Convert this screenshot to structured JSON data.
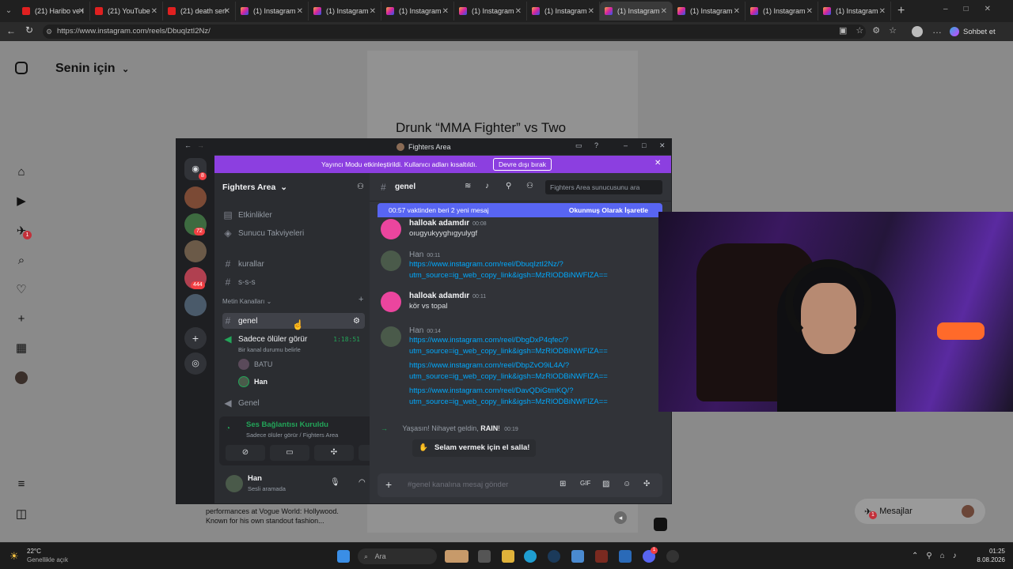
{
  "browser": {
    "tabs": [
      {
        "title": "(21) Haribo ve I",
        "icon": "youtube-icon"
      },
      {
        "title": "(21) YouTube",
        "icon": "youtube-icon"
      },
      {
        "title": "(21) death seri",
        "icon": "youtube-icon"
      },
      {
        "title": "(1) Instagram",
        "icon": "instagram-icon"
      },
      {
        "title": "(1) Instagram",
        "icon": "instagram-icon"
      },
      {
        "title": "(1) Instagram",
        "icon": "instagram-icon"
      },
      {
        "title": "(1) Instagram",
        "icon": "instagram-icon"
      },
      {
        "title": "(1) Instagram",
        "icon": "instagram-icon"
      },
      {
        "title": "(1) Instagram",
        "icon": "instagram-icon"
      },
      {
        "title": "(1) Instagram",
        "icon": "instagram-icon"
      },
      {
        "title": "(1) Instagram",
        "icon": "instagram-icon"
      },
      {
        "title": "(1) Instagram",
        "icon": "instagram-icon"
      }
    ],
    "active_tab_index": 8,
    "url": "https://www.instagram.com/reels/DbuqlztI2Nz/",
    "copilot_label": "Sohbet et"
  },
  "instagram": {
    "header_title": "Senin için",
    "reel_title": "Drunk “MMA Fighter” vs Two",
    "reel_caption_line1": "performances at Vogue World: Hollywood.",
    "reel_caption_line2": "Known for his own standout fashion...",
    "messages_label": "Mesajlar",
    "messages_badge": "1",
    "notifications_badge": "1"
  },
  "discord": {
    "window_title": "Fighters Area",
    "streamer_banner": "Yayıncı Modu etkinleştirildi. Kullanıcı adları kısaltıldı.",
    "streamer_disable_button": "Devre dışı bırak",
    "server_name": "Fighters Area",
    "server_badges": [
      "8",
      "72",
      "444"
    ],
    "top_items": [
      "Etkinlikler",
      "Sunucu Takviyeleri"
    ],
    "channels_top": [
      "kurallar",
      "s-s-s"
    ],
    "text_category": "Metin Kanalları",
    "active_channel": "genel",
    "voice_channel": "Sadece ölüler görür",
    "voice_channel_timer": "1:18:51",
    "voice_status_hint": "Bir kanal durumu belirle",
    "voice_users": [
      "BATU",
      "Han"
    ],
    "voice_channel_2": "Genel",
    "voice_connected": "Ses Bağlantısı Kuruldu",
    "voice_connected_sub": "Sadece ölüler görür / Fighters Area",
    "user_name": "Han",
    "user_status": "Sesli aramada",
    "channel_header": "genel",
    "search_placeholder": "Fighters Area sunucusunu ara",
    "new_messages_bar": "00:57 vaktinden beri 2 yeni mesaj",
    "mark_read": "Okunmuş Olarak İşaretle",
    "messages": [
      {
        "author": "halloak adamdır",
        "time": "00:08",
        "lines": [
          "oıugyukyyghıgyulygf"
        ]
      },
      {
        "author": "Han",
        "time": "00:11",
        "links": [
          "https://www.instagram.com/reel/DbuqIztI2Nz/?",
          "utm_source=ig_web_copy_link&igsh=MzRlODBiNWFlZA=="
        ]
      },
      {
        "author": "halloak adamdır",
        "time": "00:11",
        "lines": [
          "kör vs topal"
        ]
      },
      {
        "author": "Han",
        "time": "00:14",
        "links": [
          "https://www.instagram.com/reel/DbgDxP4qfec/?",
          "utm_source=ig_web_copy_link&igsh=MzRlODBiNWFlZA==",
          "https://www.instagram.com/reel/DbpZvO9iL4A/?",
          "utm_source=ig_web_copy_link&igsh=MzRlODBiNWFlZA==",
          "https://www.instagram.com/reel/DavQDiGtmKQ/?",
          "utm_source=ig_web_copy_link&igsh=MzRlODBiNWFlZA=="
        ]
      }
    ],
    "join_message": "Yaşasın! Nihayet geldin,",
    "join_user": "RAIN",
    "join_time": "00:19",
    "wave_button": "Selam vermek için el salla!",
    "composer_placeholder": "#genel kanalına mesaj gönder"
  },
  "taskbar": {
    "weather_temp": "22°C",
    "weather_desc": "Genellikle açık",
    "search_placeholder": "Ara",
    "time": "01:25",
    "date": "8.08.2026",
    "discord_badge": "1"
  }
}
